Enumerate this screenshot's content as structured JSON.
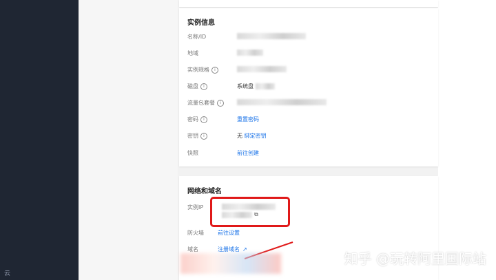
{
  "sidebar": {
    "bottom_text": "云"
  },
  "instance_info": {
    "title": "实例信息",
    "rows": [
      {
        "label": "名称/ID",
        "value": ""
      },
      {
        "label": "地域",
        "value": ""
      },
      {
        "label": "实例规格",
        "value": ""
      },
      {
        "label": "磁盘",
        "value": "系统盘"
      },
      {
        "label": "流量包套餐",
        "value": ""
      },
      {
        "label": "密码",
        "value": "",
        "link": "重置密码"
      },
      {
        "label": "密钥",
        "value": "无",
        "link": "绑定密钥"
      },
      {
        "label": "快照",
        "value": "",
        "link": "前往创建"
      }
    ]
  },
  "network": {
    "title": "网络和域名",
    "rows": [
      {
        "label": "实例IP",
        "value": ""
      },
      {
        "label": "防火墙",
        "link": "前往设置"
      },
      {
        "label": "域名",
        "link": "注册域名"
      }
    ]
  },
  "watermark": "知乎 @玩转阿里国际站",
  "colors": {
    "link": "#1a73e8",
    "highlight": "#e01919",
    "sidebar": "#1f2633"
  },
  "icons": {
    "info": "info-icon",
    "copy": "copy-icon",
    "external": "external-link-icon"
  }
}
